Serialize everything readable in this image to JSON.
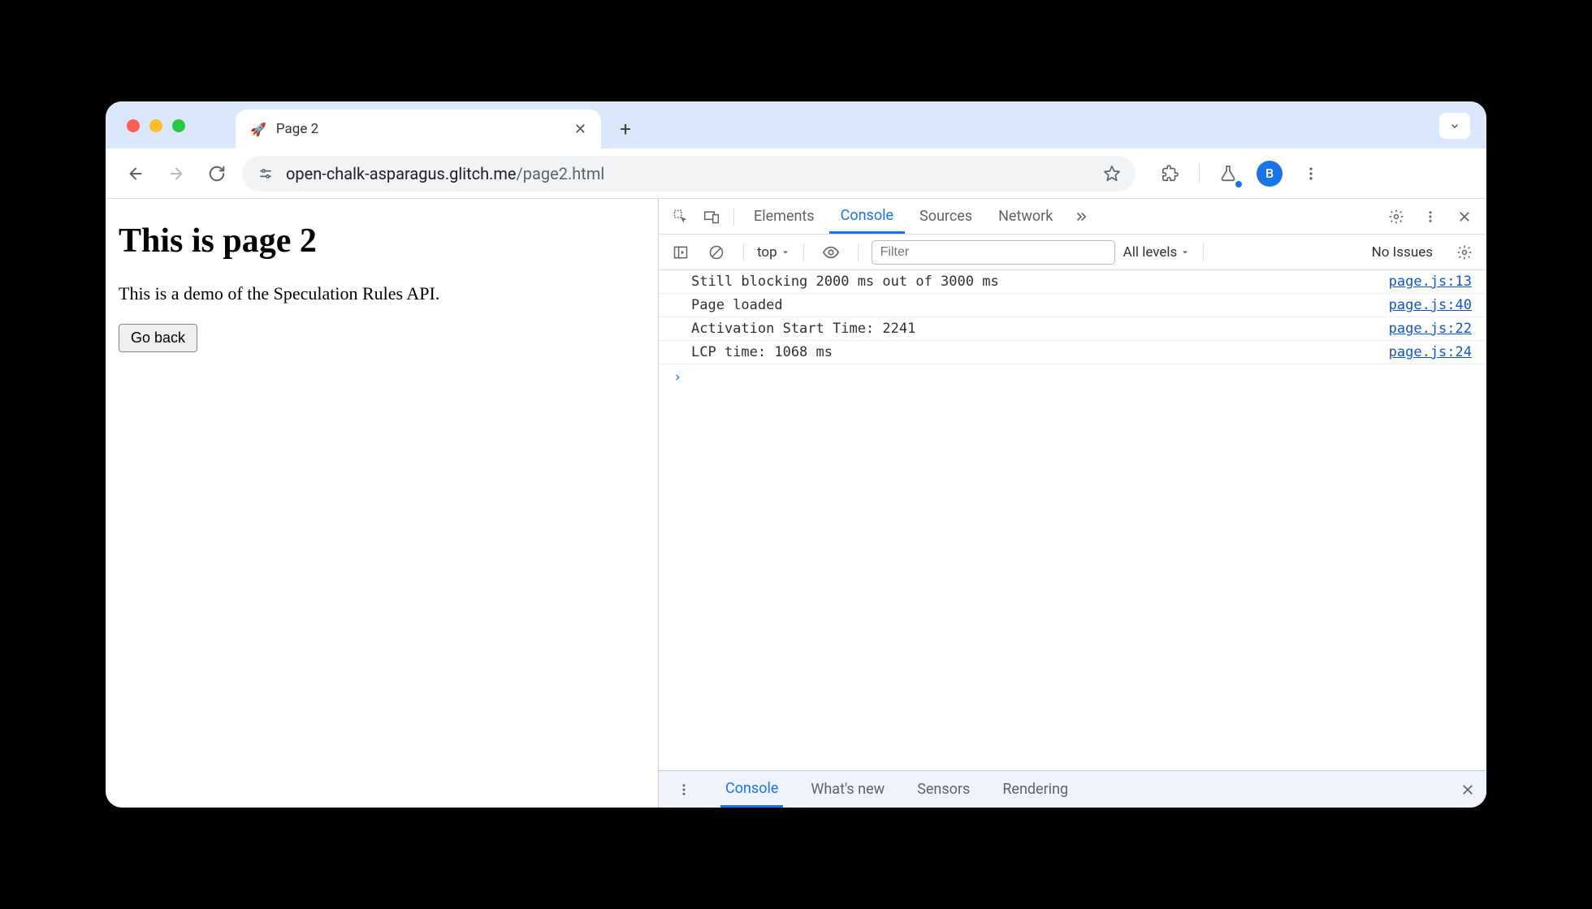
{
  "tab": {
    "title": "Page 2",
    "favicon": "🚀"
  },
  "url": {
    "host": "open-chalk-asparagus.glitch.me",
    "path": "/page2.html"
  },
  "avatar_letter": "B",
  "page": {
    "heading": "This is page 2",
    "description": "This is a demo of the Speculation Rules API.",
    "back_button": "Go back"
  },
  "devtools": {
    "tabs": [
      "Elements",
      "Console",
      "Sources",
      "Network"
    ],
    "active_tab": "Console",
    "context": "top",
    "filter_placeholder": "Filter",
    "levels": "All levels",
    "issues": "No Issues",
    "logs": [
      {
        "msg": "Still blocking 2000 ms out of 3000 ms",
        "src": "page.js:13"
      },
      {
        "msg": "Page loaded",
        "src": "page.js:40"
      },
      {
        "msg": "Activation Start Time: 2241",
        "src": "page.js:22"
      },
      {
        "msg": "LCP time: 1068 ms",
        "src": "page.js:24"
      }
    ],
    "drawer_tabs": [
      "Console",
      "What's new",
      "Sensors",
      "Rendering"
    ],
    "drawer_active": "Console"
  }
}
